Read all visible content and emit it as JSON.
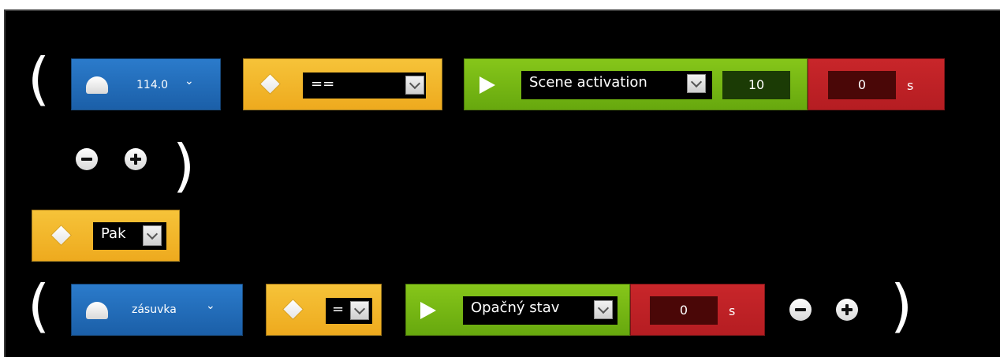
{
  "colors": {
    "background": "#000000",
    "device_blue": "#1b5fa8",
    "operator_orange": "#eeaa1e",
    "action_green": "#67a80e",
    "delay_red": "#b51d22"
  },
  "rule1": {
    "open_paren": "(",
    "close_paren": ")",
    "device": {
      "label": "114.0",
      "icon": "device-cloud-icon",
      "chevron": "⌄"
    },
    "operator": {
      "icon": "diamond-icon",
      "value": "=="
    },
    "action": {
      "icon": "play-icon",
      "value": "Scene activation",
      "param": "10"
    },
    "delay": {
      "value": "0",
      "unit": "s"
    },
    "remove_icon": "minus-circle-icon",
    "add_icon": "plus-circle-icon"
  },
  "connector": {
    "icon": "diamond-icon",
    "value": "Pak"
  },
  "rule2": {
    "open_paren": "(",
    "close_paren": ")",
    "device": {
      "label": "zásuvka",
      "icon": "device-cloud-icon",
      "chevron": "⌄"
    },
    "operator": {
      "icon": "diamond-icon",
      "value": "="
    },
    "action": {
      "icon": "play-icon",
      "value": "Opačný stav"
    },
    "delay": {
      "value": "0",
      "unit": "s"
    },
    "remove_icon": "minus-circle-icon",
    "add_icon": "plus-circle-icon"
  }
}
